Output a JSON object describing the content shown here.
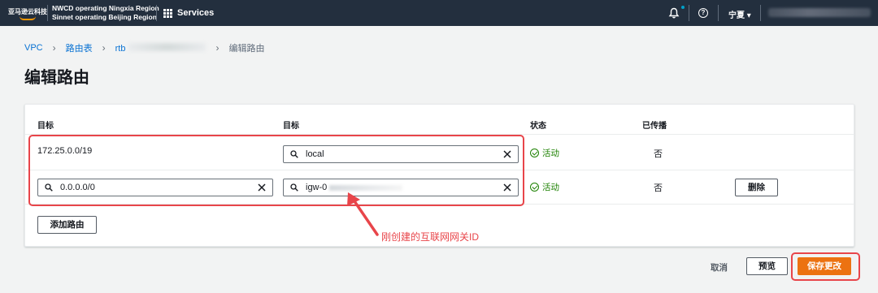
{
  "nav": {
    "logo_text": "亚马逊云科技",
    "region_line1": "NWCD operating Ningxia Region",
    "region_line2": "Sinnet operating Beijing Region",
    "services_label": "Services",
    "help_glyph": "?",
    "region_select": "宁夏 ▾"
  },
  "breadcrumb": {
    "items": [
      "VPC",
      "路由表",
      "rtb",
      "编辑路由"
    ],
    "separator": "›"
  },
  "page_title": "编辑路由",
  "table": {
    "headers": [
      "目标",
      "目标",
      "状态",
      "已传播"
    ],
    "rows": [
      {
        "destination": "172.25.0.0/19",
        "target": "local",
        "status": "活动",
        "propagated": "否"
      },
      {
        "destination": "0.0.0.0/0",
        "target": "igw-0",
        "status": "活动",
        "propagated": "否",
        "action": "删除"
      }
    ]
  },
  "add_route_label": "添加路由",
  "footer": {
    "cancel_label": "取消",
    "preview_label": "预览",
    "save_label": "保存更改"
  },
  "annotation": {
    "text": "刚创建的互联网网关ID",
    "color": "#e8454a"
  },
  "colors": {
    "nav_bg": "#232f3e",
    "link": "#0972d3",
    "primary": "#ec7211",
    "status_ok": "#1d8102"
  }
}
